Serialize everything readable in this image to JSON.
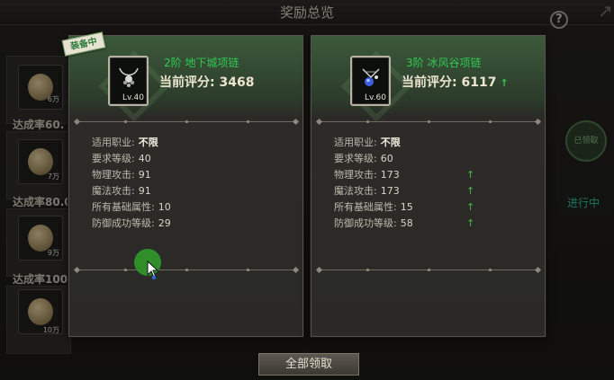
{
  "header": {
    "title": "奖励总览",
    "help_glyph": "?",
    "close_glyph": "↗"
  },
  "background_list": {
    "rows": [
      {
        "label": "",
        "coin_value": "6万"
      },
      {
        "label": "达成率60.",
        "coin_value": "7万"
      },
      {
        "label": "达成率80.0",
        "coin_value": "9万"
      },
      {
        "label": "达成率100",
        "coin_value": "10万"
      }
    ],
    "status": "进行中",
    "badge_text": "已领取"
  },
  "collect_button": "全部领取",
  "equipped_tag": "装备中",
  "cards": [
    {
      "item_name": "2阶 地下城项链",
      "level": "Lv.40",
      "score_label": "当前评分:",
      "score": "3468",
      "stats": [
        {
          "key": "适用职业:",
          "value": "不限",
          "up": false
        },
        {
          "key": "要求等级:",
          "value": "40",
          "up": false
        },
        {
          "key": "物理攻击:",
          "value": "91",
          "up": false
        },
        {
          "key": "魔法攻击:",
          "value": "91",
          "up": false
        },
        {
          "key": "所有基础属性:",
          "value": "10",
          "up": false
        },
        {
          "key": "防御成功等级:",
          "value": "29",
          "up": false
        }
      ]
    },
    {
      "item_name": "3阶 冰风谷项链",
      "level": "Lv.60",
      "score_label": "当前评分:",
      "score": "6117",
      "score_up": true,
      "stats": [
        {
          "key": "适用职业:",
          "value": "不限",
          "up": false
        },
        {
          "key": "要求等级:",
          "value": "60",
          "up": false
        },
        {
          "key": "物理攻击:",
          "value": "173",
          "up": true
        },
        {
          "key": "魔法攻击:",
          "value": "173",
          "up": true
        },
        {
          "key": "所有基础属性:",
          "value": "15",
          "up": true
        },
        {
          "key": "防御成功等级:",
          "value": "58",
          "up": true
        }
      ]
    }
  ],
  "icons": {
    "up_arrow": "↑",
    "help": "help-icon",
    "close": "close-icon"
  },
  "colors": {
    "item_name": "#2fcb54",
    "up_arrow": "#47b84a",
    "status": "#2fb48f"
  }
}
